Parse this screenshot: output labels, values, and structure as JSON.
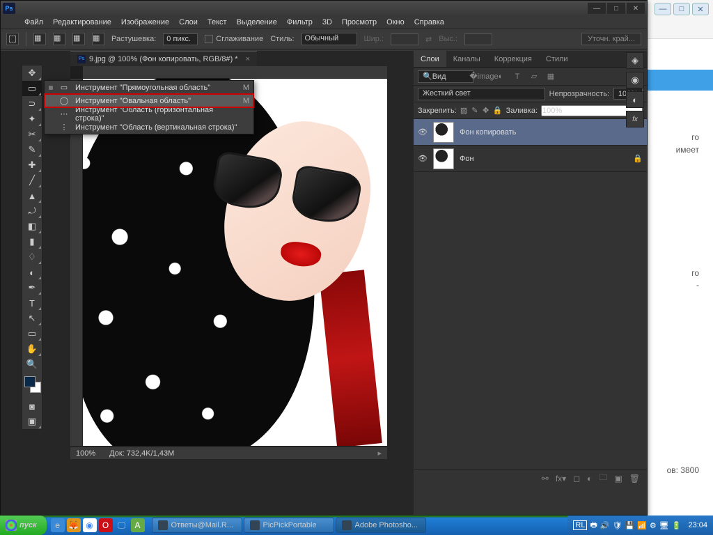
{
  "bg": {
    "txt1": "го",
    "txt2": "имеет",
    "txt3": "го",
    "txt4": "-",
    "views": "ов: 3800"
  },
  "menu": [
    "Файл",
    "Редактирование",
    "Изображение",
    "Слои",
    "Текст",
    "Выделение",
    "Фильтр",
    "3D",
    "Просмотр",
    "Окно",
    "Справка"
  ],
  "optbar": {
    "feather": "Растушевка:",
    "featherVal": "0 пикс.",
    "antialias": "Сглаживание",
    "style": "Стиль:",
    "styleVal": "Обычный",
    "width": "Шир.:",
    "height": "Выс.:",
    "refine": "Уточн. край..."
  },
  "docTab": "9.jpg @ 100% (Фон копировать, RGB/8#) *",
  "flyout": [
    {
      "icon": "▭",
      "label": "Инструмент \"Прямоугольная область\"",
      "key": "M",
      "sel": false,
      "dot": true
    },
    {
      "icon": "◯",
      "label": "Инструмент \"Овальная область\"",
      "key": "M",
      "sel": true,
      "dot": false
    },
    {
      "icon": "⋯",
      "label": "Инструмент \"Область (горизонтальная строка)\"",
      "key": "",
      "sel": false,
      "dot": false
    },
    {
      "icon": "⋮",
      "label": "Инструмент \"Область (вертикальная строка)\"",
      "key": "",
      "sel": false,
      "dot": false
    }
  ],
  "status": {
    "zoom": "100%",
    "doc": "Док: 732,4K/1,43M"
  },
  "panel": {
    "tabs": [
      "Слои",
      "Каналы",
      "Коррекция",
      "Стили"
    ],
    "filter": "Вид",
    "blend": "Жесткий свет",
    "opacityLbl": "Непрозрачность:",
    "opacity": "100%",
    "lockLbl": "Закрепить:",
    "fillLbl": "Заливка:",
    "fill": "100%",
    "layers": [
      {
        "name": "Фон копировать",
        "sel": true,
        "locked": false
      },
      {
        "name": "Фон",
        "sel": false,
        "locked": true
      }
    ]
  },
  "taskbar": {
    "start": "пуск",
    "tasks": [
      {
        "label": "Ответы@Mail.R..."
      },
      {
        "label": "PicPickPortable"
      },
      {
        "label": "Adobe Photosho...",
        "active": true
      }
    ],
    "lang": "RL",
    "time": "23:04"
  }
}
